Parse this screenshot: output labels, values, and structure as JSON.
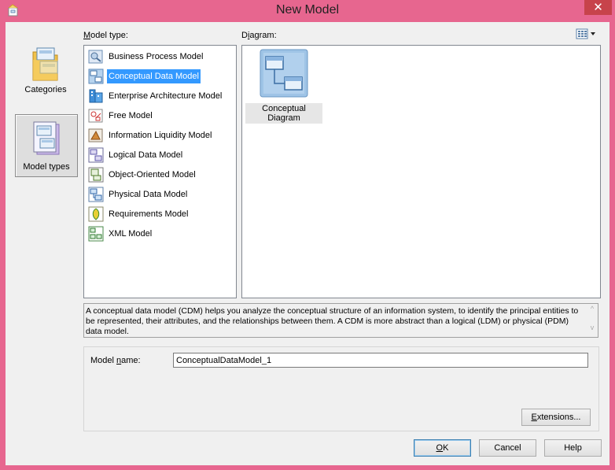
{
  "window": {
    "title": "New Model",
    "close_symbol": "✕"
  },
  "nav": {
    "categories_label": "Categories",
    "model_types_label": "Model types"
  },
  "labels": {
    "model_type": "Model type:",
    "model_type_accel": "M",
    "model_type_rest": "odel type:",
    "diagram_accel": "i",
    "diagram_pre": "D",
    "diagram_rest": "agram:"
  },
  "model_types": [
    {
      "label": "Business Process Model",
      "icon": "business-process-icon",
      "selected": false
    },
    {
      "label": "Conceptual Data Model",
      "icon": "conceptual-data-icon",
      "selected": true
    },
    {
      "label": "Enterprise Architecture Model",
      "icon": "enterprise-architecture-icon",
      "selected": false
    },
    {
      "label": "Free Model",
      "icon": "free-model-icon",
      "selected": false
    },
    {
      "label": "Information Liquidity Model",
      "icon": "information-liquidity-icon",
      "selected": false
    },
    {
      "label": "Logical Data Model",
      "icon": "logical-data-icon",
      "selected": false
    },
    {
      "label": "Object-Oriented Model",
      "icon": "object-oriented-icon",
      "selected": false
    },
    {
      "label": "Physical Data Model",
      "icon": "physical-data-icon",
      "selected": false
    },
    {
      "label": "Requirements Model",
      "icon": "requirements-icon",
      "selected": false
    },
    {
      "label": "XML Model",
      "icon": "xml-model-icon",
      "selected": false
    }
  ],
  "diagram": {
    "item_label": "Conceptual Diagram"
  },
  "description": "A conceptual data model (CDM) helps you analyze the conceptual structure of an information system, to identify the principal entities to be represented, their attributes, and the relationships between them. A CDM is more abstract than a logical (LDM) or physical (PDM) data model.",
  "model_name": {
    "label_pre": "Model ",
    "label_accel": "n",
    "label_rest": "ame:",
    "value": "ConceptualDataModel_1"
  },
  "buttons": {
    "extensions_accel": "E",
    "extensions_rest": "xtensions...",
    "ok_accel": "O",
    "ok_rest": "K",
    "cancel": "Cancel",
    "help": "Help"
  },
  "colors": {
    "frame": "#e7668f",
    "selection": "#3399ff",
    "close": "#c7434b"
  }
}
